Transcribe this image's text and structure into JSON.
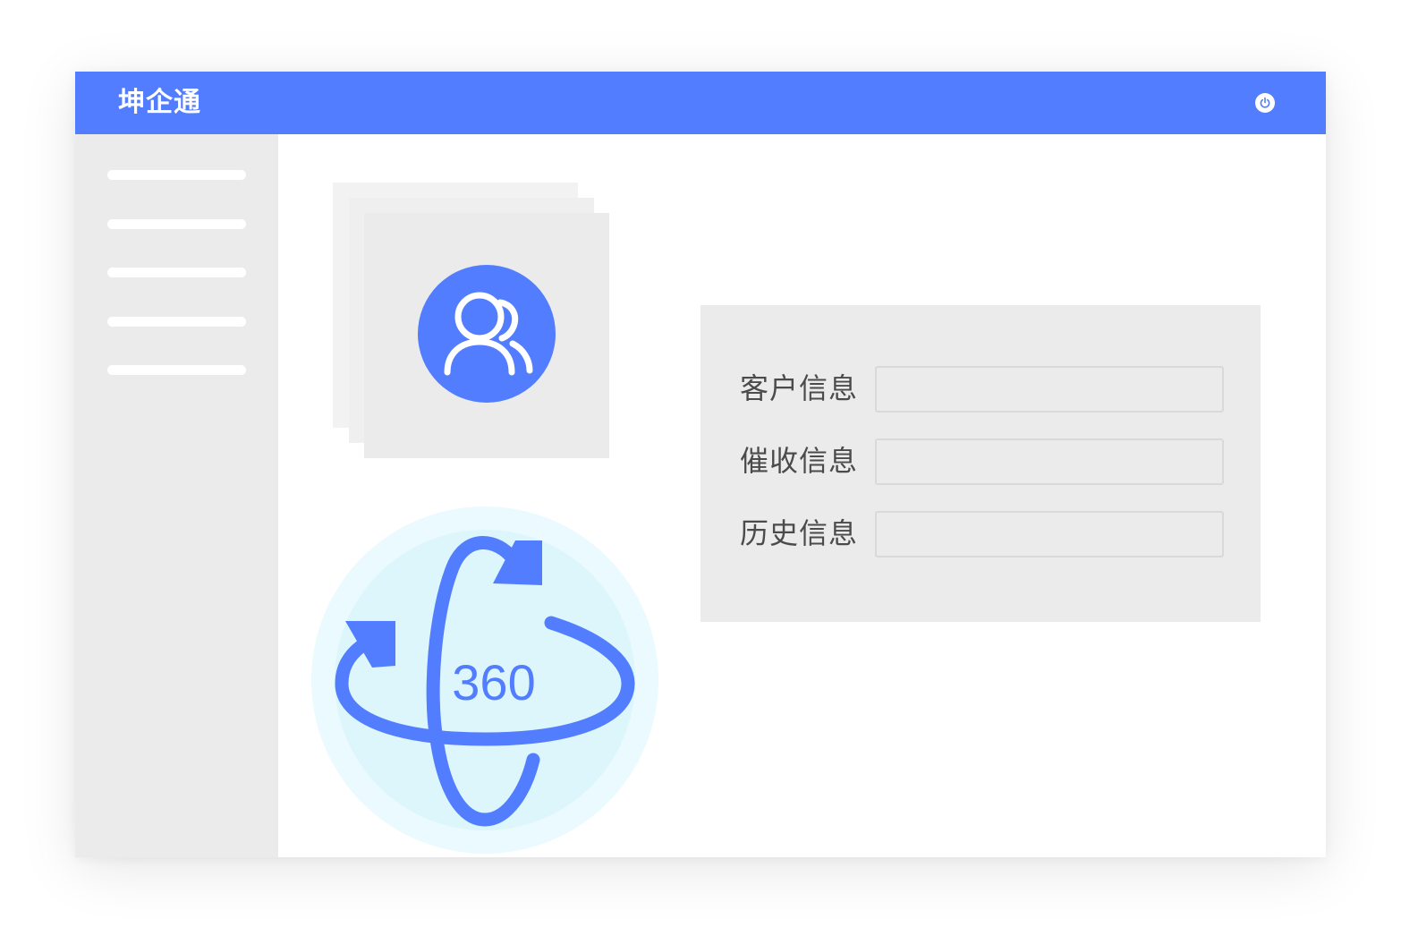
{
  "app": {
    "title": "坤企通",
    "brand_color": "#527dfe"
  },
  "header": {
    "power_icon": "power-icon"
  },
  "sidebar": {
    "items": [
      {
        "label": ""
      },
      {
        "label": ""
      },
      {
        "label": ""
      },
      {
        "label": ""
      },
      {
        "label": ""
      }
    ]
  },
  "illustration": {
    "customer_icon": "users-icon",
    "rotate_badge_text": "360"
  },
  "form": {
    "fields": [
      {
        "label": "客户信息",
        "value": ""
      },
      {
        "label": "催收信息",
        "value": ""
      },
      {
        "label": "历史信息",
        "value": ""
      }
    ]
  }
}
